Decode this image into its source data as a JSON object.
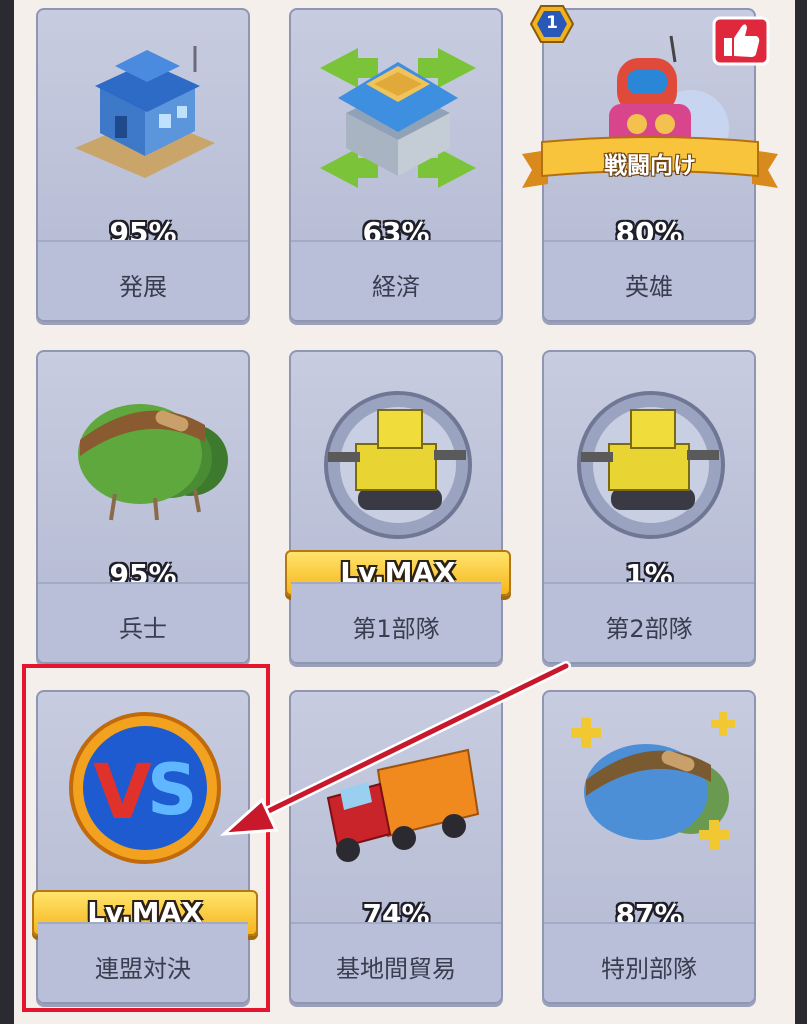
{
  "cards": [
    {
      "label": "発展",
      "progress": "95%"
    },
    {
      "label": "経済",
      "progress": "63%"
    },
    {
      "label": "英雄",
      "progress": "80%",
      "ribbon": "戦闘向け",
      "notification_count": "1"
    },
    {
      "label": "兵士",
      "progress": "95%"
    },
    {
      "label": "第1部隊",
      "level": "Lv.MAX"
    },
    {
      "label": "第2部隊",
      "progress": "1%"
    },
    {
      "label": "連盟対決",
      "level": "Lv.MAX"
    },
    {
      "label": "基地間貿易",
      "progress": "74%"
    },
    {
      "label": "特別部隊",
      "progress": "87%"
    }
  ],
  "icons": {
    "card1": "building-icon",
    "card2": "economy-building-icon",
    "card3": "hero-robot-icon",
    "card4": "soldier-helmet-icon",
    "card5": "tank-icon",
    "card6": "tank-icon",
    "card7": "vs-emblem-icon",
    "card8": "truck-icon",
    "card9": "special-helmet-icon",
    "like": "thumbs-up-icon"
  },
  "colors": {
    "highlight": "#e3152f",
    "arrow": "#c8182c",
    "gold": "#f6b51d",
    "card": "#bfc5dc"
  }
}
